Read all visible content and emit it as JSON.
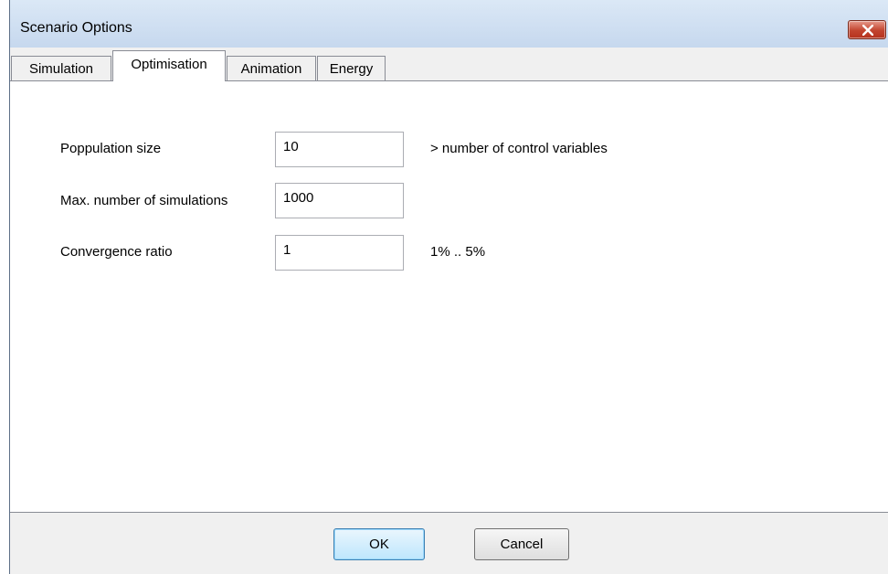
{
  "window": {
    "title": "Scenario Options",
    "close_icon": "close-icon"
  },
  "tabs": [
    {
      "label": "Simulation",
      "active": false
    },
    {
      "label": "Optimisation",
      "active": true
    },
    {
      "label": "Animation",
      "active": false
    },
    {
      "label": "Energy",
      "active": false
    }
  ],
  "form": {
    "population_size": {
      "label": "Poppulation size",
      "value": "10",
      "hint": "> number of control variables"
    },
    "max_simulations": {
      "label": "Max. number of simulations",
      "value": "1000"
    },
    "convergence_ratio": {
      "label": "Convergence ratio",
      "value": "1",
      "hint": "1% .. 5%"
    }
  },
  "buttons": {
    "ok": "OK",
    "cancel": "Cancel"
  },
  "colors": {
    "title_bar": "#c6d8ee",
    "close_button": "#c2432e",
    "ok_button_accent": "#bee6fd"
  }
}
